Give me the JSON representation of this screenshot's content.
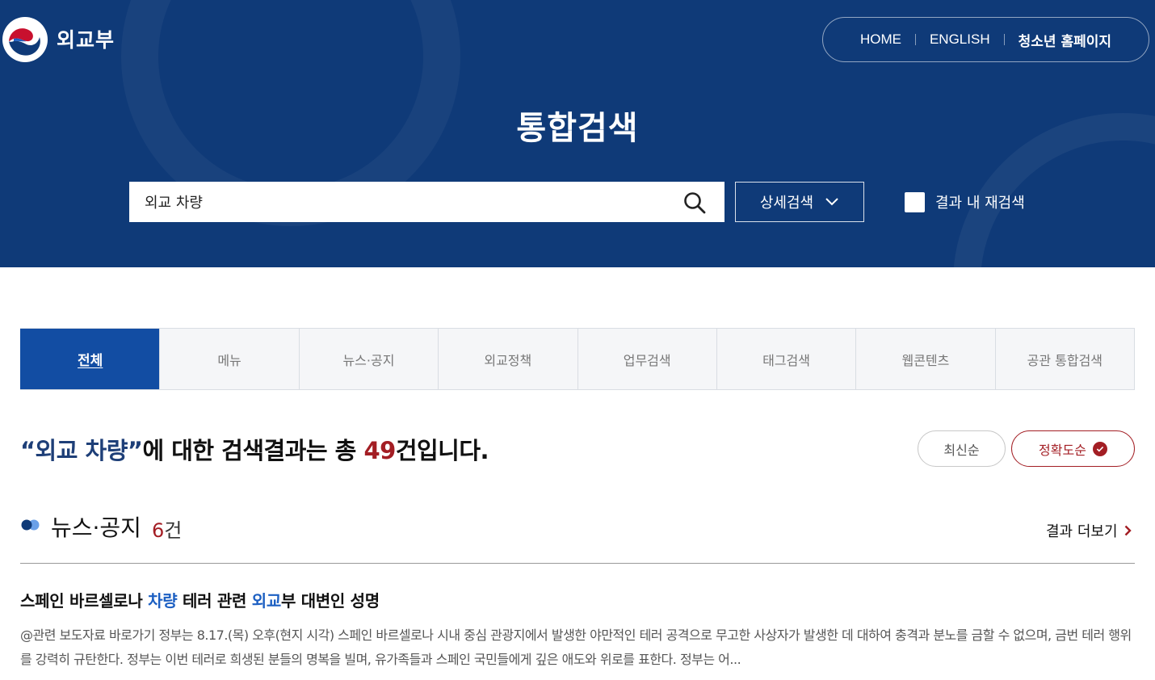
{
  "header": {
    "logo_text": "외교부",
    "nav": {
      "home": "HOME",
      "english": "ENGLISH",
      "youth": "청소년 홈페이지"
    },
    "title": "통합검색"
  },
  "search": {
    "value": "외교 차량",
    "advanced_label": "상세검색",
    "research_label": "결과 내 재검색",
    "research_checked": false
  },
  "tabs": [
    {
      "label": "전체",
      "active": true
    },
    {
      "label": "메뉴",
      "active": false
    },
    {
      "label": "뉴스·공지",
      "active": false
    },
    {
      "label": "외교정책",
      "active": false
    },
    {
      "label": "업무검색",
      "active": false
    },
    {
      "label": "태그검색",
      "active": false
    },
    {
      "label": "웹콘텐츠",
      "active": false
    },
    {
      "label": "공관 통합검색",
      "active": false
    }
  ],
  "summary": {
    "keyword": "“외교 차량”",
    "middle": "에 대한 검색결과는 총 ",
    "count": "49",
    "suffix": "건입니다."
  },
  "sort": {
    "recent": "최신순",
    "accuracy": "정확도순",
    "active": "accuracy"
  },
  "section": {
    "title": "뉴스·공지",
    "count": "6",
    "count_unit": "건",
    "more_label": "결과 더보기",
    "items": [
      {
        "title_parts": [
          {
            "text": "스페인 바르셀로나 ",
            "hl": false
          },
          {
            "text": "차량",
            "hl": true
          },
          {
            "text": " 테러 관련 ",
            "hl": false
          },
          {
            "text": "외교",
            "hl": true
          },
          {
            "text": "부 대변인 성명",
            "hl": false
          }
        ],
        "desc": "@관련 보도자료 바로가기 정부는 8.17.(목) 오후(현지 시각) 스페인 바르셀로나 시내 중심 관광지에서 발생한 야만적인 테러 공격으로 무고한 사상자가 발생한 데 대하여 충격과 분노를 금할 수 없으며, 금번 테러 행위를 강력히 규탄한다. 정부는 이번 테러로 희생된 분들의 명복을 빌며, 유가족들과 스페인 국민들에게 깊은 애도와 위로를 표한다. 정부는 어..."
      }
    ]
  },
  "colors": {
    "header_bg": "#0f3a78",
    "active_tab": "#124da3",
    "count_red": "#a31e24",
    "highlight_blue": "#1c5fc2"
  }
}
